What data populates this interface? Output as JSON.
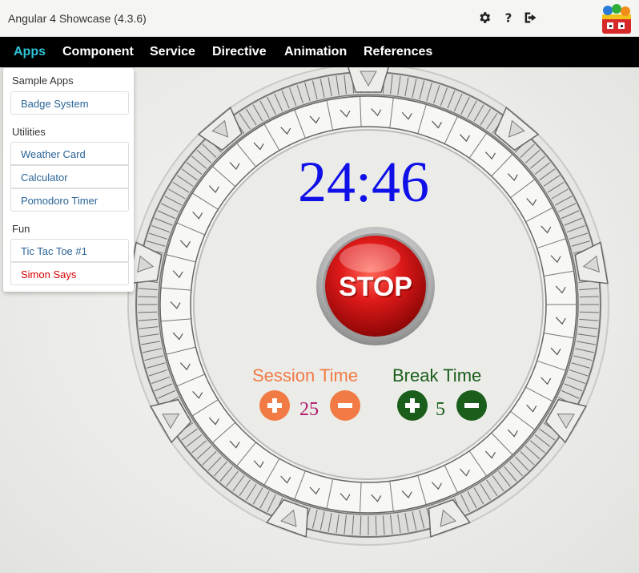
{
  "app": {
    "title": "Angular 4 Showcase (4.3.6)"
  },
  "toolbar": {
    "icons": [
      "gear-icon",
      "help-icon",
      "sign-out-icon"
    ]
  },
  "nav": {
    "items": [
      {
        "label": "Apps",
        "active": true
      },
      {
        "label": "Component",
        "active": false
      },
      {
        "label": "Service",
        "active": false
      },
      {
        "label": "Directive",
        "active": false
      },
      {
        "label": "Animation",
        "active": false
      },
      {
        "label": "References",
        "active": false
      }
    ]
  },
  "menu": {
    "sections": [
      {
        "header": "Sample Apps",
        "items": [
          "Badge System"
        ]
      },
      {
        "header": "Utilities",
        "items": [
          "Weather Card",
          "Calculator",
          "Pomodoro Timer"
        ]
      },
      {
        "header": "Fun",
        "items": [
          "Tic Tac Toe #1",
          "Simon Says"
        ]
      }
    ]
  },
  "pomodoro": {
    "time": "24:46",
    "stop_label": "STOP",
    "session_label": "Session Time",
    "session_value": "25",
    "break_label": "Break Time",
    "break_value": "5"
  },
  "colors": {
    "nav_active": "#2ec4d6",
    "timer": "#1010e8",
    "session": "#f27b45",
    "break": "#1b5e1b",
    "session_value": "#b0186b",
    "stop_red": "#e01a1a",
    "link": "#2a6496",
    "link_red": "#d40000"
  }
}
